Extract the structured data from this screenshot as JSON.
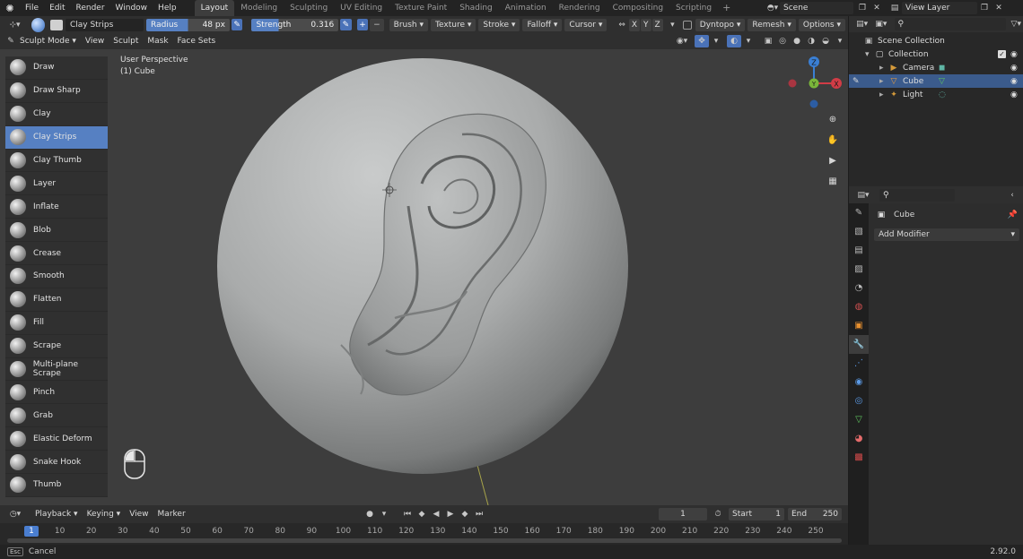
{
  "menubar": {
    "items": [
      "File",
      "Edit",
      "Render",
      "Window",
      "Help"
    ],
    "workspaces": [
      "Layout",
      "Modeling",
      "Sculpting",
      "UV Editing",
      "Texture Paint",
      "Shading",
      "Animation",
      "Rendering",
      "Compositing",
      "Scripting"
    ],
    "active_workspace": "Layout",
    "scene": "Scene",
    "view_layer": "View Layer"
  },
  "tool_header": {
    "brush_name": "Clay Strips",
    "radius_label": "Radius",
    "radius_value": "48 px",
    "radius_fill": 0.5,
    "strength_label": "Strength",
    "strength_value": "0.316",
    "strength_fill": 0.316,
    "plus": "+",
    "minus": "−",
    "brush": "Brush",
    "texture": "Texture",
    "stroke": "Stroke",
    "falloff": "Falloff",
    "cursor": "Cursor",
    "x": "X",
    "y": "Y",
    "z": "Z",
    "dyntopo": "Dyntopo",
    "remesh": "Remesh",
    "options": "Options"
  },
  "viewport_header": {
    "mode": "Sculpt Mode",
    "menus": [
      "View",
      "Sculpt",
      "Mask",
      "Face Sets"
    ]
  },
  "viewport": {
    "perspective": "User Perspective",
    "object": "(1) Cube",
    "gizmo": {
      "x": "X",
      "y": "Y",
      "z": "Z"
    }
  },
  "tools": [
    "Draw",
    "Draw Sharp",
    "Clay",
    "Clay Strips",
    "Clay Thumb",
    "Layer",
    "Inflate",
    "Blob",
    "Crease",
    "Smooth",
    "Flatten",
    "Fill",
    "Scrape",
    "Multi-plane Scrape",
    "Pinch",
    "Grab",
    "Elastic Deform",
    "Snake Hook",
    "Thumb"
  ],
  "active_tool": "Clay Strips",
  "timeline": {
    "menus": [
      "Playback",
      "Keying",
      "View",
      "Marker"
    ],
    "current_frame": "1",
    "start_label": "Start",
    "start": "1",
    "end_label": "End",
    "end": "250",
    "ticks": [
      "10",
      "20",
      "30",
      "40",
      "50",
      "60",
      "70",
      "80",
      "90",
      "100",
      "110",
      "120",
      "130",
      "140",
      "150",
      "160",
      "170",
      "180",
      "190",
      "200",
      "210",
      "220",
      "230",
      "240",
      "250"
    ],
    "cursor_label": "1"
  },
  "outliner": {
    "root": "Scene Collection",
    "collection": "Collection",
    "objects": [
      {
        "name": "Camera",
        "icon": "camera-icon",
        "color": "#d59a3a"
      },
      {
        "name": "Cube",
        "icon": "mesh-icon",
        "color": "#e69a40"
      },
      {
        "name": "Light",
        "icon": "light-icon",
        "color": "#d59a3a"
      }
    ],
    "selected": "Cube"
  },
  "properties": {
    "object": "Cube",
    "add_modifier": "Add Modifier"
  },
  "status": {
    "hint": "Cancel",
    "version": "2.92.0",
    "key": "Esc"
  },
  "colors": {
    "accent": "#5680c2",
    "viewport_bg": "#3d3d3d",
    "axis_x": "#d13c46",
    "axis_y": "#7ab63a",
    "axis_z": "#3a7fd4"
  }
}
